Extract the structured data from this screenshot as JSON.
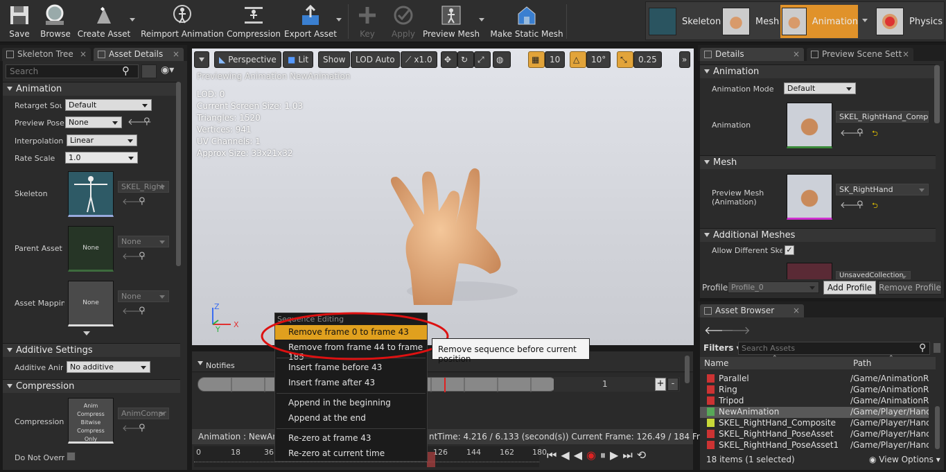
{
  "toolbar": {
    "buttons": [
      {
        "label": "Save",
        "icon": "save-icon"
      },
      {
        "label": "Browse",
        "icon": "browse-icon"
      },
      {
        "label": "Create Asset",
        "icon": "create-asset-icon"
      },
      {
        "label": "Reimport Animation",
        "icon": "reimport-icon"
      },
      {
        "label": "Compression",
        "icon": "compression-icon"
      },
      {
        "label": "Export Asset",
        "icon": "export-icon"
      },
      {
        "label": "Key",
        "icon": "key-icon"
      },
      {
        "label": "Apply",
        "icon": "apply-icon"
      },
      {
        "label": "Preview Mesh",
        "icon": "preview-mesh-icon"
      },
      {
        "label": "Make Static Mesh",
        "icon": "static-mesh-icon"
      }
    ],
    "modes": [
      "Skeleton",
      "Mesh",
      "Animation",
      "Physics"
    ]
  },
  "left": {
    "tabs": [
      "Skeleton Tree",
      "Asset Details"
    ],
    "search_placeholder": "Search",
    "sections": {
      "animation": "Animation",
      "additive": "Additive Settings",
      "compression": "Compression"
    },
    "props": {
      "retarget_label": "Retarget Sour",
      "retarget_value": "Default",
      "preview_pose_label": "Preview Pose",
      "preview_pose_value": "None",
      "interp_label": "Interpolation",
      "interp_value": "Linear",
      "rate_label": "Rate Scale",
      "rate_value": "1.0",
      "skeleton_label": "Skeleton",
      "skeleton_value": "SKEL_Right",
      "parent_label": "Parent Asset",
      "parent_thumb": "None",
      "parent_value": "None",
      "mapping_label": "Asset Mappin",
      "mapping_thumb": "None",
      "mapping_value": "None",
      "additive_label": "Additive Anim",
      "additive_value": "No additive",
      "compression_label": "Compression",
      "compression_thumb": "Anim Compress Bitwise Compress Only",
      "compression_value": "AnimCompr",
      "dont_override_label": "Do Not Overri"
    }
  },
  "viewport": {
    "buttons": {
      "perspective": "Perspective",
      "lit": "Lit",
      "show": "Show",
      "lod": "LOD Auto",
      "speed": "x1.0",
      "grid": "10",
      "angle": "10°",
      "scale": "0.25"
    },
    "caption": "Previewing Animation NewAnimation",
    "stats": [
      "LOD: 0",
      "Current Screen Size: 1.03",
      "Triangles: 1520",
      "Vertices: 941",
      "UV Channels: 1",
      "Approx Size: 33x21x32"
    ],
    "axes": {
      "z": "Z",
      "x": "X",
      "y": "Y"
    }
  },
  "timeline": {
    "notifies_label": "Notifies",
    "track_count": "1",
    "status": "Animation : NewAni",
    "status_right": "ntTime: 4.216 / 6.133 (second(s)) Current Frame: 126.49 / 184 Frame",
    "ticks": [
      "0",
      "18",
      "36",
      "126",
      "144",
      "162",
      "180"
    ]
  },
  "menu": {
    "header": "Sequence Editing",
    "items": [
      "Remove frame 0 to frame 43",
      "Remove from frame 44 to frame 185",
      "Insert frame before 43",
      "Insert frame after 43",
      "Append in the beginning",
      "Append at the end",
      "Re-zero at frame 43",
      "Re-zero at current time"
    ],
    "tooltip": "Remove sequence before current position"
  },
  "right": {
    "tabs": [
      "Details",
      "Preview Scene Sett"
    ],
    "sections": {
      "animation": "Animation",
      "mesh": "Mesh",
      "additional": "Additional Meshes"
    },
    "anim_mode_label": "Animation Mode",
    "anim_mode_value": "Default",
    "animation_label": "Animation",
    "animation_value": "SKEL_RightHand_Compo",
    "preview_mesh_label": "Preview Mesh (Animation)",
    "preview_mesh_value": "SK_RightHand",
    "allow_label": "Allow Different Skel",
    "unsaved_value": "UnsavedCollection",
    "profile_label": "Profile",
    "profile_value": "Profile_0",
    "add_profile": "Add Profile",
    "remove_profile": "Remove Profile"
  },
  "browser": {
    "tab": "Asset Browser",
    "filters": "Filters",
    "search_placeholder": "Search Assets",
    "col_name": "Name",
    "col_path": "Path",
    "rows": [
      {
        "name": "Parallel",
        "path": "/Game/AnimationR"
      },
      {
        "name": "Ring",
        "path": "/Game/AnimationR"
      },
      {
        "name": "Tripod",
        "path": "/Game/AnimationR"
      },
      {
        "name": "NewAnimation",
        "path": "/Game/Player/Hanc"
      },
      {
        "name": "SKEL_RightHand_Composite",
        "path": "/Game/Player/Hanc"
      },
      {
        "name": "SKEL_RightHand_PoseAsset",
        "path": "/Game/Player/Hanc"
      },
      {
        "name": "SKEL_RightHand_PoseAsset1",
        "path": "/Game/Player/Hanc"
      }
    ],
    "count": "18 items (1 selected)",
    "view_options": "View Options"
  },
  "colors": {
    "accent": "#e0a01e",
    "highlight_oval": "#dd1111"
  }
}
